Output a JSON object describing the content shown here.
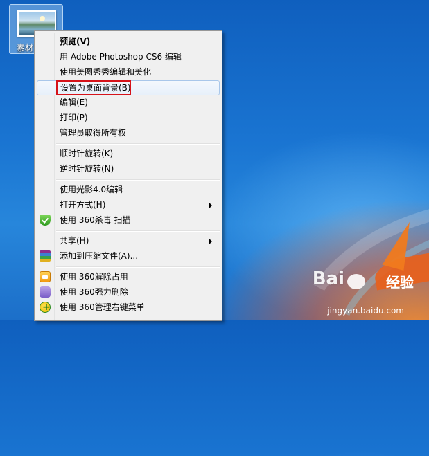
{
  "desktop": {
    "icon_label": "素材1"
  },
  "menu": {
    "items": [
      {
        "label": "预览(V)",
        "bold": true
      },
      {
        "label": "用 Adobe Photoshop CS6 编辑"
      },
      {
        "label": "使用美图秀秀编辑和美化"
      },
      {
        "label": "设置为桌面背景(B)",
        "highlighted": true
      },
      {
        "label": "编辑(E)"
      },
      {
        "label": "打印(P)"
      },
      {
        "label": "管理员取得所有权"
      },
      {
        "label": "顺时针旋转(K)"
      },
      {
        "label": "逆时针旋转(N)"
      },
      {
        "label": "使用光影4.0编辑"
      },
      {
        "label": "打开方式(H)",
        "submenu": true
      },
      {
        "label": "使用 360杀毒 扫描",
        "icon": "360-shield-icon"
      },
      {
        "label": "共享(H)",
        "submenu": true
      },
      {
        "label": "添加到压缩文件(A)...",
        "icon": "winrar-icon"
      },
      {
        "label": "使用 360解除占用",
        "icon": "unlock-icon"
      },
      {
        "label": "使用 360强力删除",
        "icon": "shred-icon"
      },
      {
        "label": "使用 360管理右键菜单",
        "icon": "manage-menu-icon"
      }
    ]
  },
  "watermark": {
    "brand": "Bai",
    "brand2": "经验",
    "url": "jingyan.baidu.com"
  },
  "colors": {
    "highlight_box": "#d6131a",
    "menu_bg": "#f0f0f0",
    "hover_border": "#a9c7ea"
  }
}
